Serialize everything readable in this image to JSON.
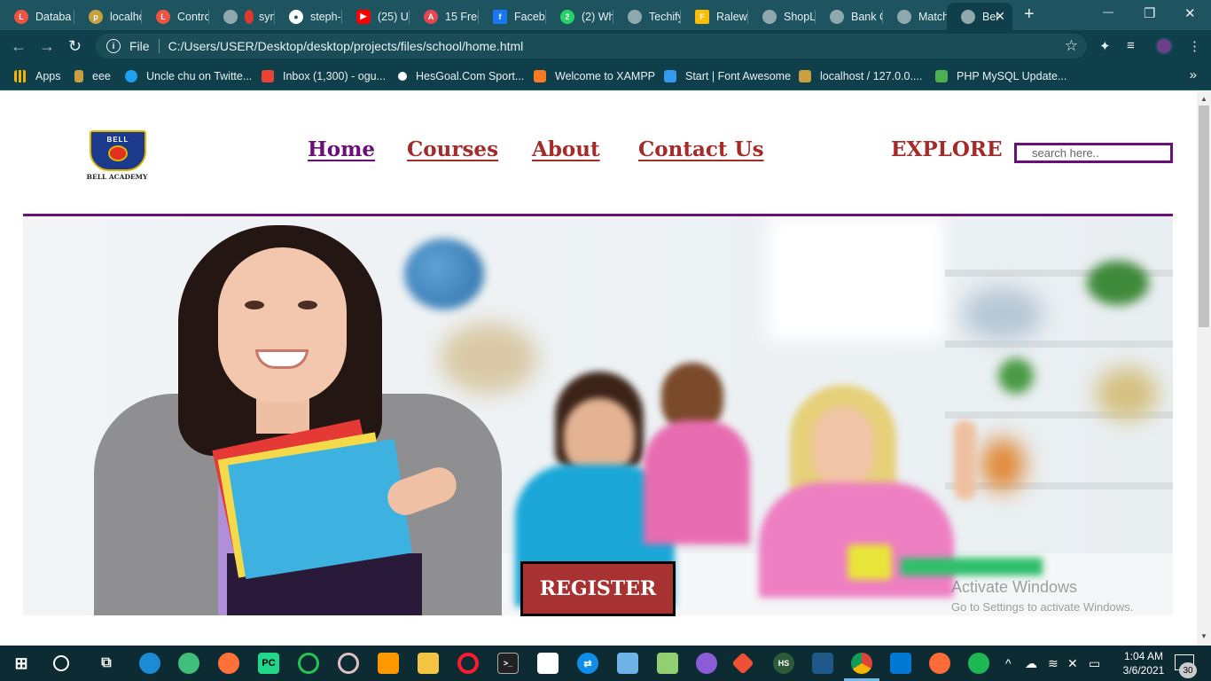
{
  "browser": {
    "tabs": [
      {
        "label": "Databa",
        "icon": "laravel-icon",
        "color": "#f05340"
      },
      {
        "label": "localho",
        "icon": "phpmyadmin-icon",
        "color": "#c8a040"
      },
      {
        "label": "Contro",
        "icon": "laravel-icon",
        "color": "#f05340"
      },
      {
        "label": "syn",
        "icon": "pen-icon",
        "color": "#e0392b"
      },
      {
        "label": "steph-",
        "icon": "github-icon",
        "color": "#ffffff"
      },
      {
        "label": "(25) Ul",
        "icon": "youtube-icon",
        "color": "#ff0000"
      },
      {
        "label": "15 Free",
        "icon": "adobe-icon",
        "color": "#e34850"
      },
      {
        "label": "Facebo",
        "icon": "facebook-icon",
        "color": "#1877f2"
      },
      {
        "label": "(2) Wh",
        "icon": "whatsapp-icon",
        "color": "#25d366"
      },
      {
        "label": "Techify",
        "icon": "globe-icon",
        "color": "#8fa8ad"
      },
      {
        "label": "Ralewa",
        "icon": "google-fonts-icon",
        "color": "#fbbc04"
      },
      {
        "label": "ShopL",
        "icon": "globe-icon",
        "color": "#8fa8ad"
      },
      {
        "label": "Bank C",
        "icon": "globe-icon",
        "color": "#8fa8ad"
      },
      {
        "label": "Match",
        "icon": "globe-icon",
        "color": "#8fa8ad"
      },
      {
        "label": "Bel",
        "icon": "globe-icon",
        "color": "#8fa8ad",
        "active": true
      }
    ],
    "new_tab": "+",
    "window_controls": {
      "minimize": "—",
      "restore": "❐",
      "close": "✕"
    },
    "address": {
      "scheme": "File",
      "url": "C:/Users/USER/Desktop/desktop/projects/files/school/home.html"
    },
    "bookmarks": [
      {
        "label": "Apps",
        "icon": "apps-grid-icon",
        "color": "#f4b400"
      },
      {
        "label": "eee",
        "icon": "phpmyadmin-icon",
        "color": "#c8a040"
      },
      {
        "label": "Uncle chu on Twitte...",
        "icon": "twitter-icon",
        "color": "#1da1f2"
      },
      {
        "label": "Inbox (1,300) - ogu...",
        "icon": "gmail-icon",
        "color": "#ea4335"
      },
      {
        "label": "HesGoal.Com Sport...",
        "icon": "ball-icon",
        "color": "#ffffff"
      },
      {
        "label": "Welcome to XAMPP",
        "icon": "xampp-icon",
        "color": "#fb7a24"
      },
      {
        "label": "Start | Font Awesome",
        "icon": "flag-icon",
        "color": "#339af0"
      },
      {
        "label": "localhost / 127.0.0....",
        "icon": "phpmyadmin-icon",
        "color": "#c8a040"
      },
      {
        "label": "PHP MySQL Update...",
        "icon": "w3schools-icon",
        "color": "#4caf50"
      }
    ],
    "bookmarks_more": "»"
  },
  "site": {
    "logo": {
      "top_text": "BELL",
      "name": "BELL ACADEMY"
    },
    "nav": [
      {
        "label": "Home",
        "active": true
      },
      {
        "label": "Courses"
      },
      {
        "label": "About"
      },
      {
        "label": "Contact Us"
      }
    ],
    "explore_label": "EXPLORE",
    "search_placeholder": "search here..",
    "register_label": "REGISTER",
    "watermark": {
      "title": "Activate Windows",
      "subtitle": "Go to Settings to activate Windows."
    },
    "colors": {
      "brand": "#a52a2a",
      "accent": "#6a0f7a"
    }
  },
  "taskbar": {
    "apps": [
      "windows-start-icon",
      "search-circle-icon",
      "task-view-icon",
      "edge-icon",
      "atom-icon",
      "firefox-icon",
      "pycharm-icon",
      "circle-app-icon",
      "media-icon",
      "sublime-icon",
      "file-explorer-icon",
      "opera-icon",
      "terminal-icon",
      "store-icon",
      "teamviewer-icon",
      "virtualbox-icon",
      "notepadpp-icon",
      "github-desktop-icon",
      "git-icon",
      "hs-icon",
      "mysql-workbench-icon",
      "chrome-icon",
      "vscode-icon",
      "postman-icon",
      "spotify-icon"
    ],
    "time": "1:04 AM",
    "date": "3/6/2021",
    "notification_count": "30"
  }
}
